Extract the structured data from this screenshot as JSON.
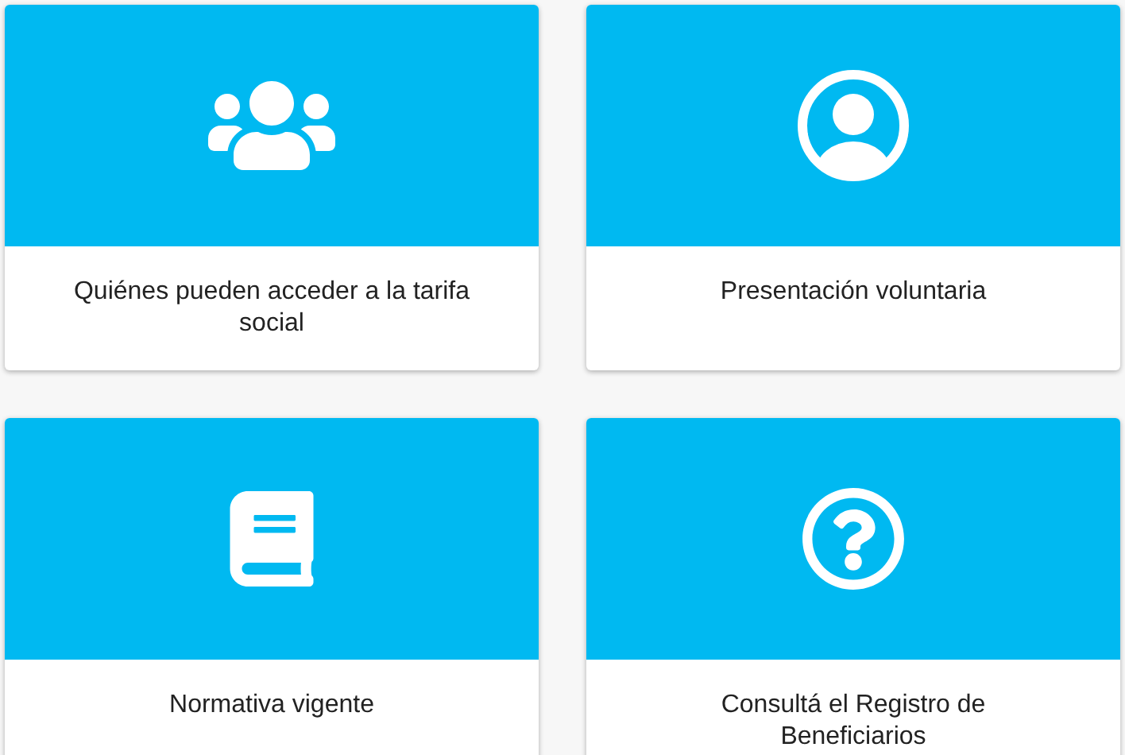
{
  "cards": [
    {
      "label": "Quiénes pueden acceder a la tarifa social"
    },
    {
      "label": "Presentación voluntaria"
    },
    {
      "label": "Normativa vigente"
    },
    {
      "label": "Consultá el Registro de Beneficiarios"
    }
  ]
}
